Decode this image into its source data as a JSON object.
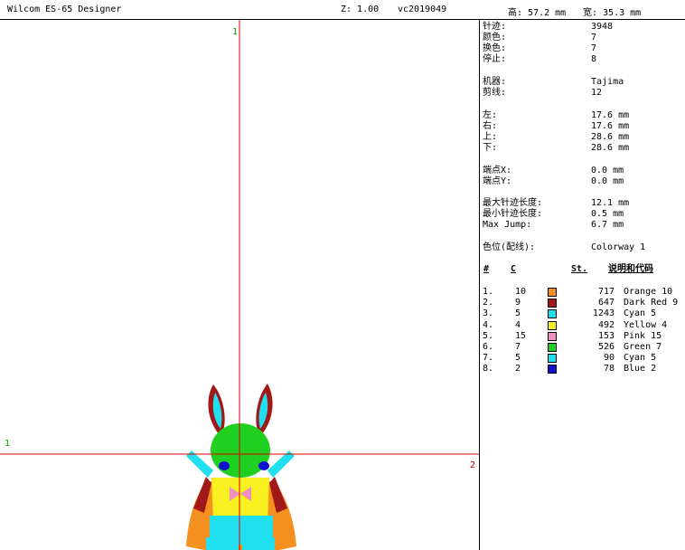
{
  "header": {
    "app_title": "Wilcom ES-65 Designer",
    "zoom": "Z: 1.00",
    "design_name": "vc2019049",
    "height": "高: 57.2 mm",
    "width": "宽: 35.3 mm"
  },
  "canvas": {
    "label_top": "1",
    "label_left": "1",
    "label_right": "2"
  },
  "stats": {
    "stitches": {
      "label": "针迹:",
      "value": "3948"
    },
    "colors": {
      "label": "颜色:",
      "value": "7"
    },
    "color_changes": {
      "label": "换色:",
      "value": "7"
    },
    "stops": {
      "label": "停止:",
      "value": "8"
    },
    "machine": {
      "label": "机器:",
      "value": "Tajima"
    },
    "trims": {
      "label": "剪线:",
      "value": "12"
    },
    "left": {
      "label": "左:",
      "value": "17.6 mm"
    },
    "right": {
      "label": "右:",
      "value": "17.6 mm"
    },
    "top": {
      "label": "上:",
      "value": "28.6 mm"
    },
    "bottom": {
      "label": "下:",
      "value": "28.6 mm"
    },
    "end_x": {
      "label": "端点X:",
      "value": "0.0 mm"
    },
    "end_y": {
      "label": "端点Y:",
      "value": "0.0 mm"
    },
    "max_stitch": {
      "label": "最大针迹长度:",
      "value": "12.1 mm"
    },
    "min_stitch": {
      "label": "最小针迹长度:",
      "value": "0.5 mm"
    },
    "max_jump": {
      "label": "Max Jump:",
      "value": "6.7 mm"
    },
    "colorway": {
      "label": "色位(配线):",
      "value": "Colorway 1"
    }
  },
  "table": {
    "headers": {
      "num": "#",
      "code": "C",
      "stitches": "St.",
      "desc": "说明和代码"
    },
    "rows": [
      {
        "num": "1.",
        "code": "10",
        "stitches": "717",
        "desc": "Orange 10",
        "color": "#f39020"
      },
      {
        "num": "2.",
        "code": "9",
        "stitches": "647",
        "desc": "Dark Red 9",
        "color": "#a01818"
      },
      {
        "num": "3.",
        "code": "5",
        "stitches": "1243",
        "desc": "Cyan 5",
        "color": "#20e0f0"
      },
      {
        "num": "4.",
        "code": "4",
        "stitches": "492",
        "desc": "Yellow 4",
        "color": "#f8f020"
      },
      {
        "num": "5.",
        "code": "15",
        "stitches": "153",
        "desc": "Pink 15",
        "color": "#f090c0"
      },
      {
        "num": "6.",
        "code": "7",
        "stitches": "526",
        "desc": "Green 7",
        "color": "#20d020"
      },
      {
        "num": "7.",
        "code": "5",
        "stitches": "90",
        "desc": "Cyan 5",
        "color": "#20e0f0"
      },
      {
        "num": "8.",
        "code": "2",
        "stitches": "78",
        "desc": "Blue 2",
        "color": "#1010d0"
      }
    ]
  }
}
